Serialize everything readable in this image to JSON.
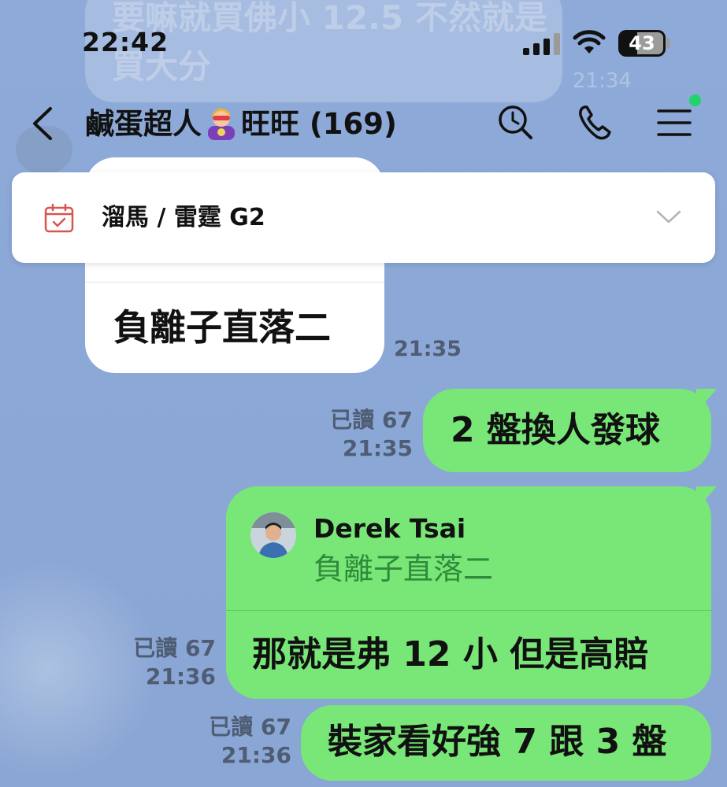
{
  "status_bar": {
    "time": "22:42",
    "battery": "43"
  },
  "background_message": {
    "text": "要嘛就買佛小 12.5 不然就是買大分",
    "time": "21:34"
  },
  "header": {
    "title_before_emoji": "鹹蛋超人",
    "title_emoji": "superhero-emoji",
    "title_after_emoji": "旺旺 (169)",
    "icons": [
      "back-icon",
      "search-icon",
      "phone-icon",
      "menu-icon"
    ],
    "online_indicator_color": "#1fd46a"
  },
  "pinned_announcement": {
    "icon": "calendar-icon",
    "text": "溜馬 / 雷霆 G2"
  },
  "messages": [
    {
      "direction": "incoming",
      "text": "負離子直落二",
      "time": "21:35"
    },
    {
      "direction": "outgoing",
      "text": "2 盤換人發球",
      "read": "已讀 67",
      "time": "21:35"
    },
    {
      "direction": "outgoing",
      "reply_to": {
        "name": "Derek Tsai",
        "text": "負離子直落二"
      },
      "text": "那就是弗 12 小 但是高賠",
      "read": "已讀 67",
      "time": "21:36"
    },
    {
      "direction": "outgoing",
      "text": "裝家看好強 7 跟 3 盤",
      "read": "已讀 67",
      "time": "21:36"
    }
  ],
  "colors": {
    "chat_background": "#8ca8d6",
    "outgoing_bubble": "#79e777",
    "incoming_bubble": "#ffffff",
    "reply_quote_text": "#2f8a3b"
  }
}
